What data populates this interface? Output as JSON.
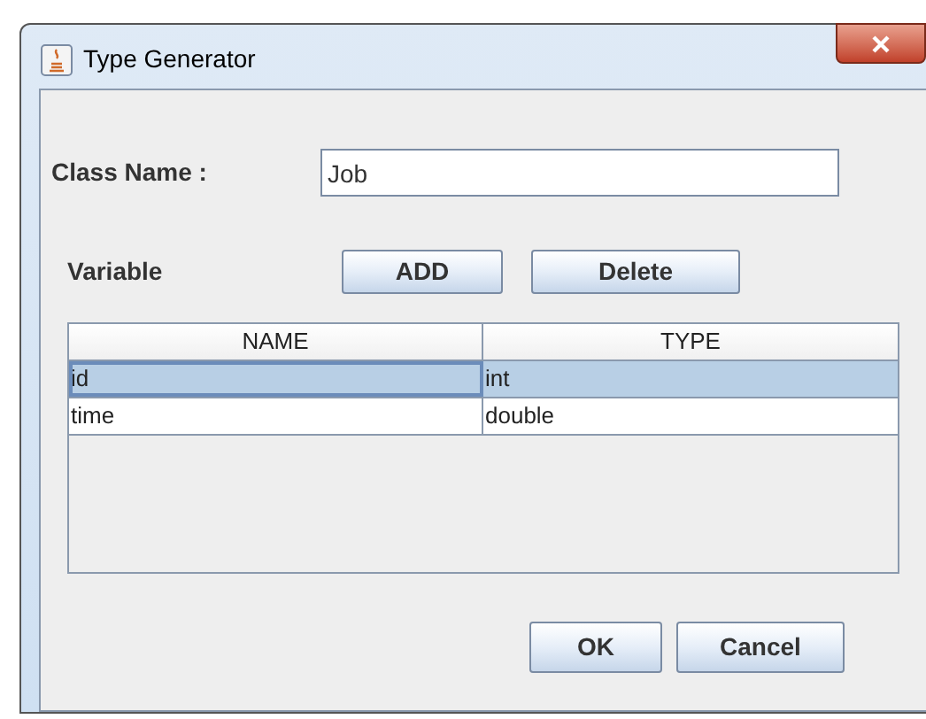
{
  "window": {
    "title": "Type Generator"
  },
  "class_name": {
    "label": "Class Name :",
    "value": "Job"
  },
  "variable": {
    "label": "Variable",
    "buttons": [
      "ADD",
      "Delete"
    ]
  },
  "table": {
    "columns": [
      "NAME",
      "TYPE"
    ],
    "rows": [
      {
        "cells": [
          "id",
          "int"
        ],
        "selected": true
      },
      {
        "cells": [
          "time",
          "double"
        ],
        "selected": false
      }
    ]
  },
  "buttons": [
    "OK",
    "Cancel"
  ]
}
